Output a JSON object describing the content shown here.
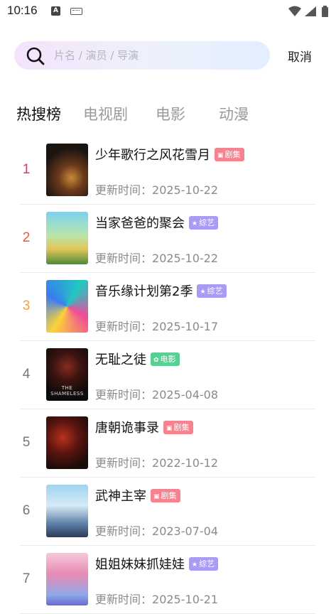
{
  "status_bar": {
    "time": "10:16",
    "a_indicator": "A"
  },
  "search": {
    "placeholder": "片名 / 演员 / 导演",
    "value": "",
    "cancel_label": "取消"
  },
  "tabs": [
    {
      "label": "热搜榜",
      "active": true
    },
    {
      "label": "电视剧",
      "active": false
    },
    {
      "label": "电影",
      "active": false
    },
    {
      "label": "动漫",
      "active": false
    }
  ],
  "colors": {
    "rank_1": "#e8306e",
    "rank_2": "#f0533c",
    "rank_3": "#f4a33a",
    "rank_other": "#777777",
    "badge_drama": "#f4838f",
    "badge_variety": "#a79bf2",
    "badge_movie": "#58cf93"
  },
  "list": [
    {
      "rank": "1",
      "title": "少年歌行之风花雪月",
      "badge": "剧集",
      "badge_type": "drama",
      "update_prefix": "更新时间：",
      "date": "2025-10-22",
      "poster_icon": "poster-shaonian"
    },
    {
      "rank": "2",
      "title": "当家爸爸的聚会",
      "badge": "综艺",
      "badge_type": "variety",
      "update_prefix": "更新时间：",
      "date": "2025-10-22",
      "poster_icon": "poster-dangjia"
    },
    {
      "rank": "3",
      "title": "音乐缘计划第2季",
      "badge": "综艺",
      "badge_type": "variety",
      "update_prefix": "更新时间：",
      "date": "2025-10-17",
      "poster_icon": "poster-yinyue"
    },
    {
      "rank": "4",
      "title": "无耻之徒",
      "badge": "电影",
      "badge_type": "movie",
      "update_prefix": "更新时间：",
      "date": "2025-04-08",
      "poster_icon": "poster-wuchi",
      "poster_text": "THE SHAMELESS"
    },
    {
      "rank": "5",
      "title": "唐朝诡事录",
      "badge": "剧集",
      "badge_type": "drama",
      "update_prefix": "更新时间：",
      "date": "2022-10-12",
      "poster_icon": "poster-tangchao"
    },
    {
      "rank": "6",
      "title": "武神主宰",
      "badge": "剧集",
      "badge_type": "drama",
      "update_prefix": "更新时间：",
      "date": "2023-07-04",
      "poster_icon": "poster-wushen"
    },
    {
      "rank": "7",
      "title": "姐姐妹妹抓娃娃",
      "badge": "综艺",
      "badge_type": "variety",
      "update_prefix": "更新时间：",
      "date": "2025-10-21",
      "poster_icon": "poster-jiejie"
    }
  ]
}
